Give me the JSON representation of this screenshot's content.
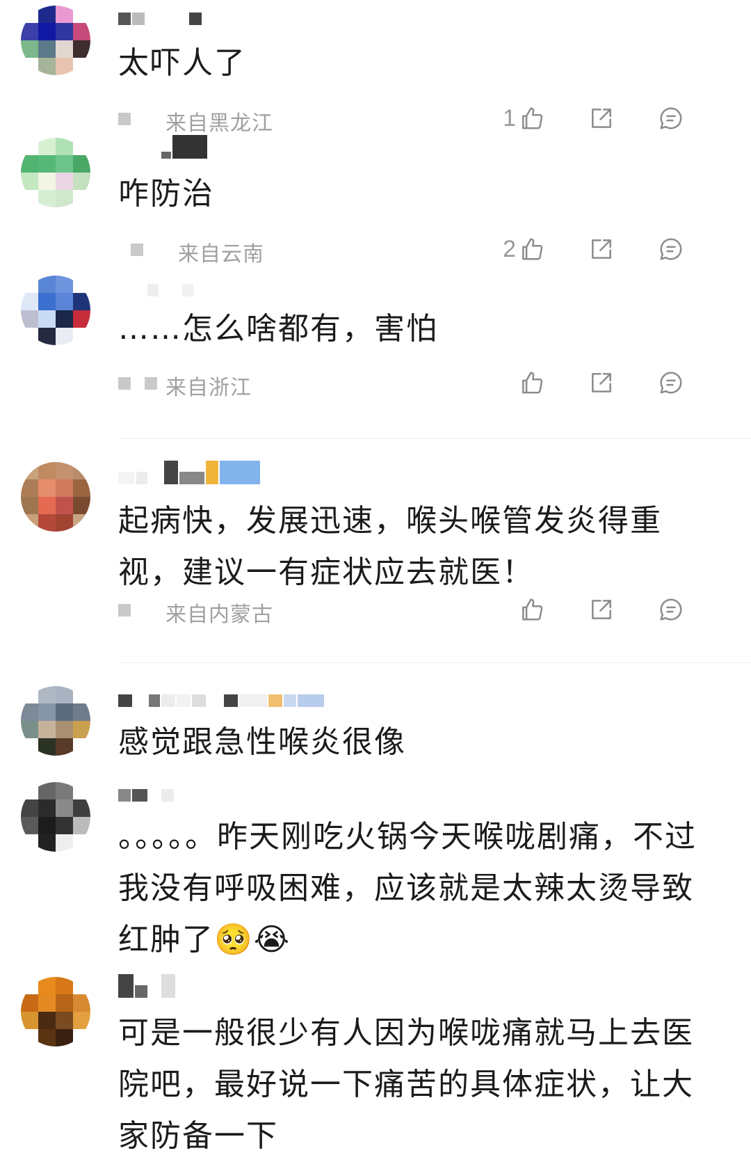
{
  "comments": [
    {
      "text": "太吓人了",
      "location": "来自黑龙江",
      "likes": "1"
    },
    {
      "text": "咋防治",
      "location": "来自云南",
      "likes": "2"
    },
    {
      "text": "……怎么啥都有，害怕",
      "location": "来自浙江",
      "likes": ""
    },
    {
      "text": "起病快，发展迅速，喉头喉管发炎得重视，建议一有症状应去就医！",
      "location": "来自内蒙古",
      "likes": ""
    },
    {
      "text": "感觉跟急性喉炎很像"
    },
    {
      "text": "。。。。。昨天刚吃火锅今天喉咙剧痛，不过我没有呼吸困难，应该就是太辣太烫导致红肿了🥺😭"
    },
    {
      "text": "可是一般很少有人因为喉咙痛就马上去医院吧，最好说一下痛苦的具体症状，让大家防备一下"
    }
  ],
  "icons": {
    "like": "thumbs-up-icon",
    "share": "share-icon",
    "reply": "reply-icon"
  },
  "colors": {
    "text": "#1b1b1b",
    "meta": "#a0a0a0",
    "icon": "#8c8c8c",
    "divider": "#eeeeee"
  }
}
